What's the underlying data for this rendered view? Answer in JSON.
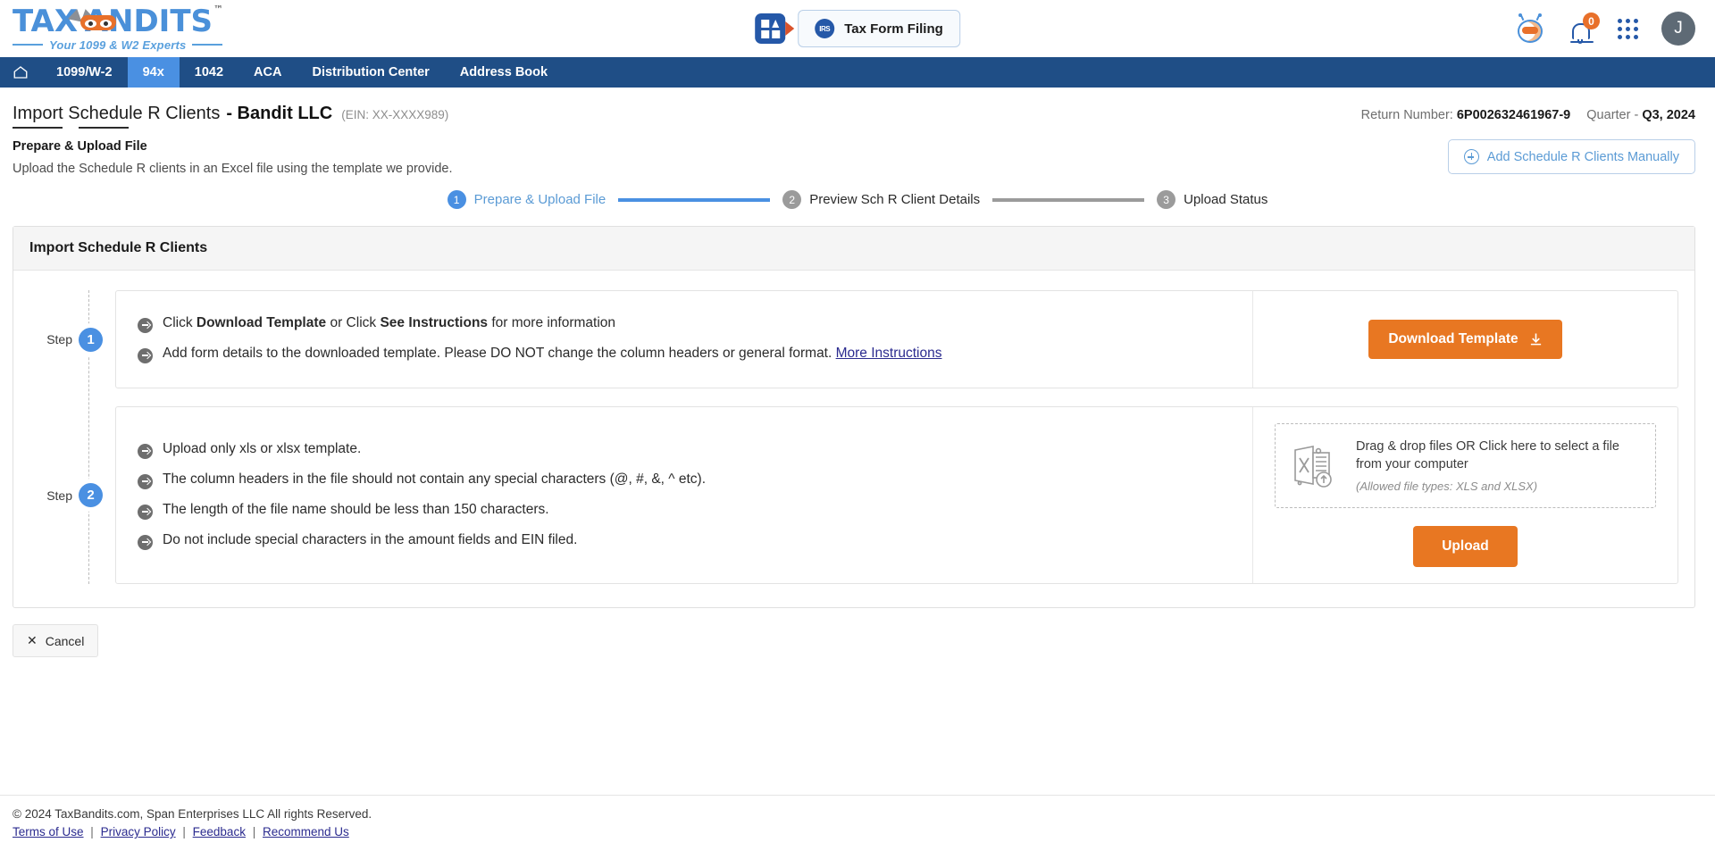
{
  "header": {
    "logo": {
      "main_pre": "TAX",
      "main_post": "ANDITS",
      "tm": "™",
      "tagline": "Your 1099 & W2 Experts"
    },
    "center": {
      "grid_icon": "apps-grid-icon",
      "irs_icon": "irs-seal-icon",
      "tax_form_label": "Tax Form Filing"
    },
    "right": {
      "bot_icon": "bandit-bot-icon",
      "bell_icon": "notification-bell-icon",
      "notification_count": "0",
      "apps_icon": "app-launcher-icon",
      "avatar_initial": "J"
    }
  },
  "nav": {
    "home_icon": "home-icon",
    "items": [
      {
        "label": "1099/W-2",
        "active": false
      },
      {
        "label": "94x",
        "active": true
      },
      {
        "label": "1042",
        "active": false
      },
      {
        "label": "ACA",
        "active": false
      },
      {
        "label": "Distribution Center",
        "active": false
      },
      {
        "label": "Address Book",
        "active": false
      }
    ]
  },
  "title": {
    "page_title": "Import Schedule R Clients",
    "business": "- Bandit LLC",
    "ein": "(EIN: XX-XXXX989)",
    "return_number_label": "Return Number:",
    "return_number": "6P002632461967-9",
    "quarter_label": "Quarter -",
    "quarter": "Q3, 2024"
  },
  "subhead": {
    "heading": "Prepare & Upload File",
    "description": "Upload the Schedule R clients in an Excel file using the template we provide.",
    "add_manually_label": "Add Schedule R Clients Manually"
  },
  "stepper": [
    {
      "num": "1",
      "label": "Prepare & Upload File",
      "active": true
    },
    {
      "num": "2",
      "label": "Preview Sch R Client Details",
      "active": false
    },
    {
      "num": "3",
      "label": "Upload Status",
      "active": false
    }
  ],
  "card": {
    "title": "Import Schedule R Clients",
    "step1": {
      "step_word": "Step",
      "num": "1",
      "bullets": [
        {
          "pre": "Click ",
          "b1": "Download Template",
          "mid": " or Click ",
          "b2": "See Instructions",
          "post": " for more information"
        },
        {
          "pre": "Add form details to the downloaded template. Please DO NOT change the column headers or general format. ",
          "link": "More Instructions"
        }
      ],
      "download_label": "Download Template",
      "download_icon": "download-icon"
    },
    "step2": {
      "step_word": "Step",
      "num": "2",
      "bullets": [
        "Upload only xls or xlsx template.",
        "The column headers in the file should not contain any special characters (@, #, &, ^ etc).",
        "The length of the file name should be less than 150 characters.",
        "Do not include special characters in the amount fields and EIN filed."
      ],
      "dropzone_icon": "excel-upload-icon",
      "dropzone_text": "Drag & drop files OR Click here to select a file from your computer",
      "dropzone_sub": "(Allowed file types: XLS and XLSX)",
      "upload_label": "Upload"
    }
  },
  "cancel": {
    "icon": "close-icon",
    "label": "Cancel"
  },
  "footer": {
    "copyright": "© 2024 TaxBandits.com, Span Enterprises LLC All rights Reserved.",
    "links": [
      "Terms of Use",
      "Privacy Policy",
      "Feedback",
      "Recommend Us"
    ],
    "separator": "|"
  },
  "colors": {
    "nav_blue": "#1f4e86",
    "active_blue": "#4a90e2",
    "orange": "#e87722",
    "link_blue": "#2b2b8f"
  }
}
